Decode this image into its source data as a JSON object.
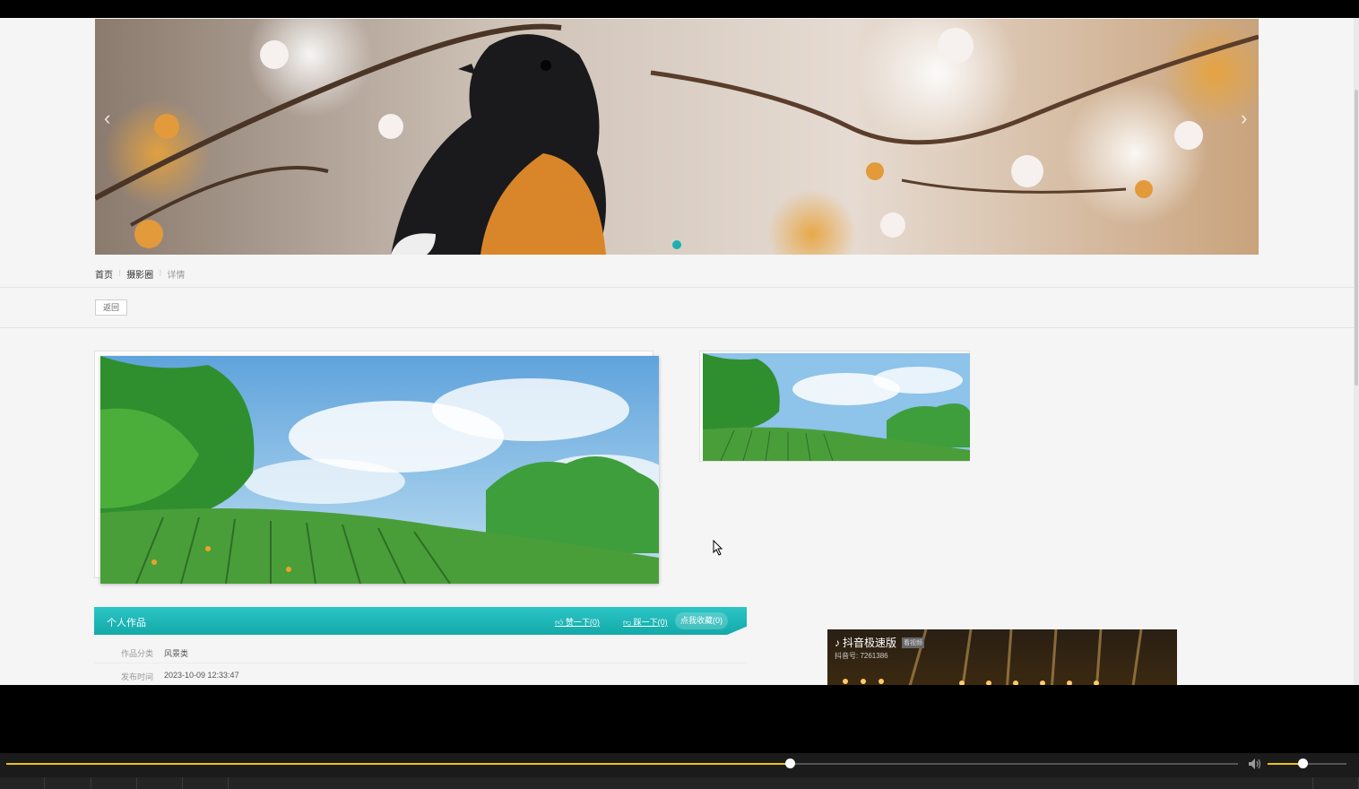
{
  "breadcrumb": {
    "home": "首页",
    "section": "摄影圈",
    "current": "详情"
  },
  "back_label": "返回",
  "banner": {
    "prev_glyph": "‹",
    "next_glyph": "›"
  },
  "work": {
    "bar_title": "个人作品",
    "like_label": "赞一下(0)",
    "dislike_label": "踩一下(0)",
    "favorite_label": "点我收藏(0)",
    "fields": [
      {
        "key": "作品分类",
        "value": "风景类"
      },
      {
        "key": "发布时间",
        "value": "2023-10-09 12:33:47"
      }
    ]
  },
  "ad": {
    "brand": "抖音极速版",
    "badge": "看视频",
    "sub": "抖音号: 7261386"
  },
  "player": {
    "progress": 0.636,
    "volume": 0.44
  },
  "colors": {
    "accent": "#1bb0b0",
    "seek": "#e8c21a"
  }
}
